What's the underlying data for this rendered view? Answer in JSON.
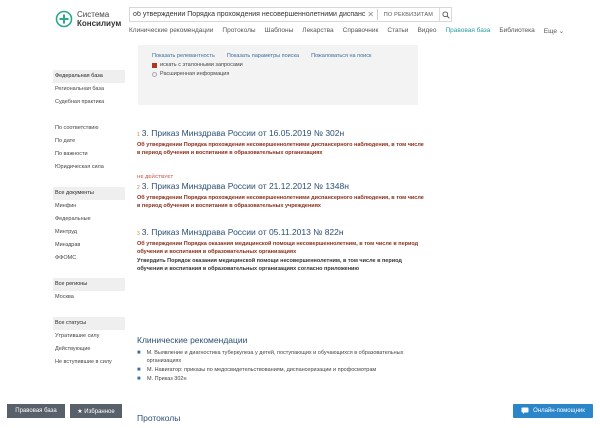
{
  "logo": {
    "line1": "Система",
    "line2": "Консилиум"
  },
  "search": {
    "value": "об утверждении Порядка прохождения несовершеннолетними диспансер",
    "clear": "✕",
    "scope_label": "ПО РЕКВИЗИТАМ"
  },
  "nav": [
    "Клинические рекомендации",
    "Протоколы",
    "Шаблоны",
    "Лекарства",
    "Справочник",
    "Статьи",
    "Видео",
    "Правовая база",
    "Библиотека",
    "Еще ⌄"
  ],
  "sidebar": {
    "groups": [
      [
        "Федеральная база",
        "Региональная база",
        "Судебная практика"
      ],
      [
        "По соответствию",
        "По дате",
        "По важности",
        "Юридическая сила"
      ],
      [
        "Все документы",
        "Минфин",
        "Федеральные",
        "Минтруд",
        "Минздрав",
        "ФФОМС"
      ],
      [
        "Все регионы",
        "Москва"
      ],
      [
        "Все статусы",
        "Утратившие силу",
        "Действующие",
        "Не вступившие в силу"
      ]
    ]
  },
  "searchbox": {
    "links": [
      "Показать релевантность",
      "Показать параметры поиска",
      "Пожаловаться на поиск"
    ],
    "option1": "искать с эталонными запросами",
    "option2": "Расширенная информация"
  },
  "results": [
    {
      "num": "1",
      "notice": "",
      "title": "3. Приказ Минздрава России от 16.05.2019 № 302н",
      "snippet": "Об утверждении Порядка прохождения несовершеннолетними диспансерного наблюдения, в том числе в период обучения и воспитания в образовательных организациях"
    },
    {
      "num": "2",
      "notice": "НЕ ДЕЙСТВУЕТ",
      "title": "3. Приказ Минздрава России от 21.12.2012 № 1348н",
      "snippet": "Об утверждении Порядка прохождения несовершеннолетними диспансерного наблюдения, в том числе в период обучения и воспитания в образовательных учреждениях"
    },
    {
      "num": "3",
      "notice": "",
      "title": "3. Приказ Минздрава России от 05.11.2013 № 822н",
      "snippet": "Об утверждении Порядка оказания медицинской помощи несовершеннолетним, в том числе в период обучения и воспитания в образовательных организациях",
      "snippet2": "Утвердить Порядок оказания медицинской помощи несовершеннолетним, в том числе в период обучения и воспитания в образовательных организациях согласно приложению"
    }
  ],
  "clinical": {
    "title": "Клинические рекомендации",
    "items": [
      "М. Выявление и диагностика туберкулеза у детей, поступающих и обучающихся в образовательных организациях",
      "М. Навигатор: приказы по медосвидетельствованиям, диспансеризации и профосмотрам",
      "М. Приказ 302н"
    ]
  },
  "protocols": {
    "title": "Протоколы"
  },
  "bottom": {
    "law": "Правовая база",
    "fav": "★ Избранное",
    "help": "Онлайн-помощник"
  }
}
